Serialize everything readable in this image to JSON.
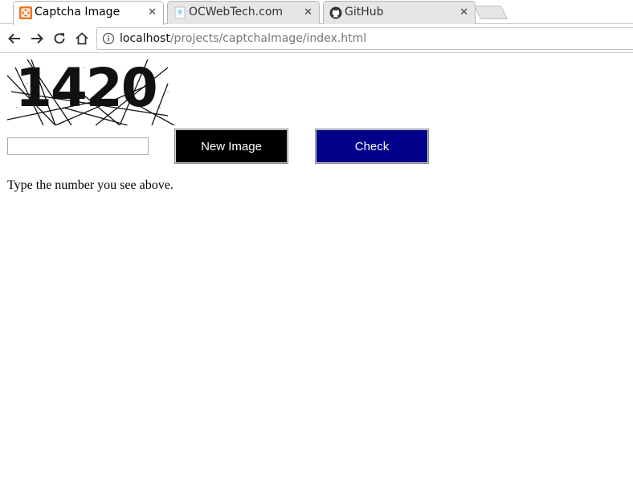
{
  "browser": {
    "tabs": [
      {
        "title": "Captcha Image",
        "icon": "xampp-icon",
        "active": true
      },
      {
        "title": "OCWebTech.com",
        "icon": "page-icon",
        "active": false
      },
      {
        "title": "GitHub",
        "icon": "github-icon",
        "active": false
      }
    ],
    "close_glyph": "✕",
    "address": {
      "host": "localhost",
      "path": "/projects/captchaImage/index.html"
    }
  },
  "captcha": {
    "image_text": "1420",
    "input_value": "",
    "new_image_label": "New Image",
    "check_label": "Check",
    "instruction": "Type the number you see above."
  },
  "colors": {
    "new_image_button": "#000000",
    "check_button": "#00008b",
    "xampp_orange": "#f27123"
  }
}
